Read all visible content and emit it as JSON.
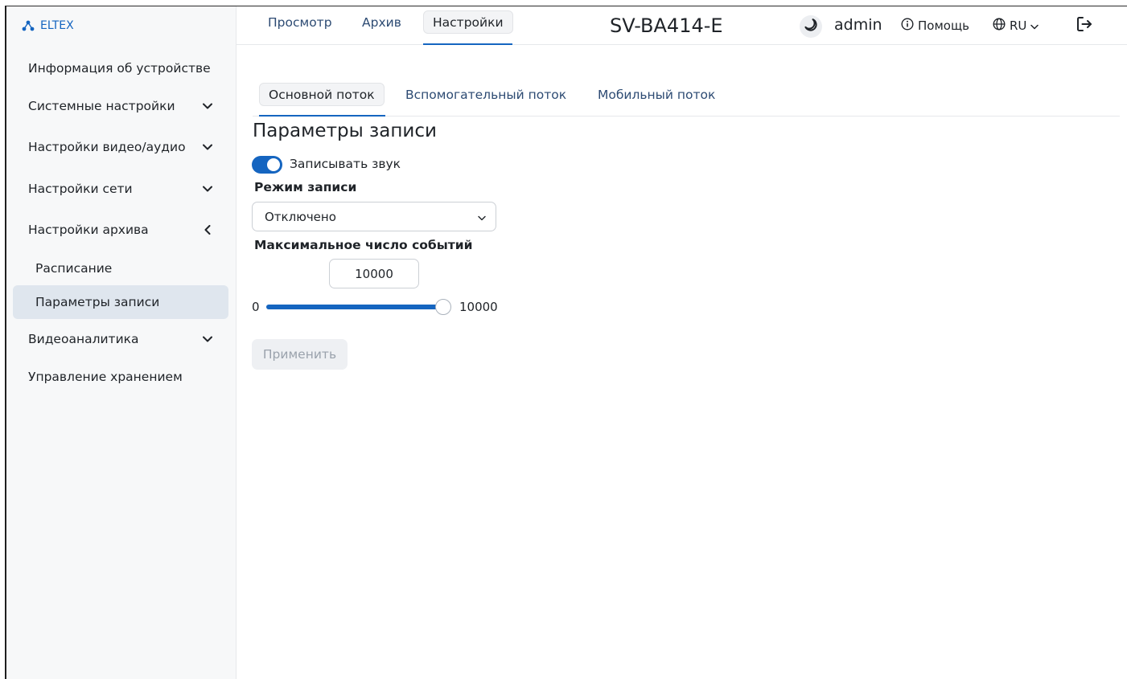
{
  "brand": {
    "name": "ELTEX",
    "icon": "eltex-logo-icon",
    "color": "#1565c0"
  },
  "sidebar": {
    "items": [
      {
        "label": "Информация об устройстве",
        "icon": ""
      },
      {
        "label": "Системные настройки",
        "icon": "chevron-down-icon"
      },
      {
        "label": "Настройки видео/аудио",
        "icon": "chevron-down-icon"
      },
      {
        "label": "Настройки сети",
        "icon": "chevron-down-icon"
      },
      {
        "label": "Настройки архива",
        "icon": "chevron-left-icon"
      },
      {
        "label": "Видеоаналитика",
        "icon": "chevron-down-icon"
      },
      {
        "label": "Управление хранением",
        "icon": ""
      }
    ],
    "archive_sub": [
      {
        "label": "Расписание",
        "active": false
      },
      {
        "label": "Параметры записи",
        "active": true
      }
    ]
  },
  "header": {
    "tabs": [
      {
        "label": "Просмотр",
        "active": false
      },
      {
        "label": "Архив",
        "active": false
      },
      {
        "label": "Настройки",
        "active": true
      }
    ],
    "device_name": "SV-BA414-E",
    "theme_icon": "moon-icon",
    "user": "admin",
    "help_label": "Помощь",
    "help_icon": "info-icon",
    "lang_label": "RU",
    "lang_icon": "globe-icon",
    "logout_icon": "logout-icon"
  },
  "main": {
    "stream_tabs": [
      {
        "label": "Основной поток",
        "active": true
      },
      {
        "label": "Вспомогательный поток",
        "active": false
      },
      {
        "label": "Мобильный поток",
        "active": false
      }
    ],
    "section_title": "Параметры записи",
    "record_audio": {
      "label": "Записывать звук",
      "enabled": true
    },
    "record_mode": {
      "label": "Режим записи",
      "value": "Отключено"
    },
    "max_events": {
      "label": "Максимальное число событий",
      "value": "10000",
      "min": "0",
      "max": "10000",
      "level": 1.0
    },
    "apply_label": "Применить"
  },
  "colors": {
    "accent": "#1565c0",
    "active_bg": "#dfe6ee",
    "tab_text": "#2d4b73"
  }
}
